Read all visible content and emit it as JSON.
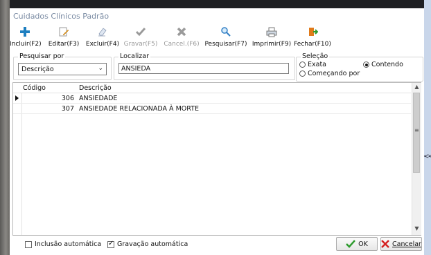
{
  "window": {
    "title": "Cuidados Clínicos Padrão"
  },
  "toolbar": [
    {
      "id": "incluir",
      "label": "Incluir(F2)",
      "icon": "plus-icon",
      "enabled": true
    },
    {
      "id": "editar",
      "label": "Editar(F3)",
      "icon": "edit-icon",
      "enabled": true
    },
    {
      "id": "excluir",
      "label": "Excluir(F4)",
      "icon": "eraser-icon",
      "enabled": true
    },
    {
      "id": "gravar",
      "label": "Gravar(F5)",
      "icon": "checkmark-icon",
      "enabled": false
    },
    {
      "id": "cancelar",
      "label": "Cancel.(F6)",
      "icon": "x-icon",
      "enabled": false
    },
    {
      "id": "pesquisar",
      "label": "Pesquisar(F7)",
      "icon": "magnifier-icon",
      "enabled": true
    },
    {
      "id": "imprimir",
      "label": "Imprimir(F9)",
      "icon": "printer-icon",
      "enabled": true
    },
    {
      "id": "fechar",
      "label": "Fechar(F10)",
      "icon": "exit-door-icon",
      "enabled": true
    }
  ],
  "search": {
    "pesquisar_por_label": "Pesquisar por",
    "pesquisar_por_value": "Descrição",
    "localizar_label": "Localizar",
    "localizar_value": "ANSIEDA",
    "selecao_label": "Seleção",
    "options": {
      "exata": "Exata",
      "comecando": "Começando por",
      "contendo": "Contendo"
    },
    "selected_option": "contendo"
  },
  "grid": {
    "columns": {
      "codigo": "Código",
      "descricao": "Descrição"
    },
    "rows": [
      {
        "codigo": "306",
        "descricao": "ANSIEDADE"
      },
      {
        "codigo": "307",
        "descricao": "ANSIEDADE RELACIONADA À MORTE"
      }
    ]
  },
  "footer": {
    "inclusao_automatica": "Inclusão automática",
    "inclusao_checked": false,
    "gravacao_automatica": "Gravação automática",
    "gravacao_checked": true,
    "ok_label": "OK",
    "cancelar_label": "Cancelar"
  },
  "colors": {
    "title_text": "#7a8ba3",
    "plus": "#1e7fc0",
    "ok_check": "#2e9b2e",
    "cancel_x": "#d42020",
    "disabled": "#9a9a9a",
    "exit": "#e07a1a"
  },
  "side_panel": {
    "collapse_glyph": "<<"
  }
}
